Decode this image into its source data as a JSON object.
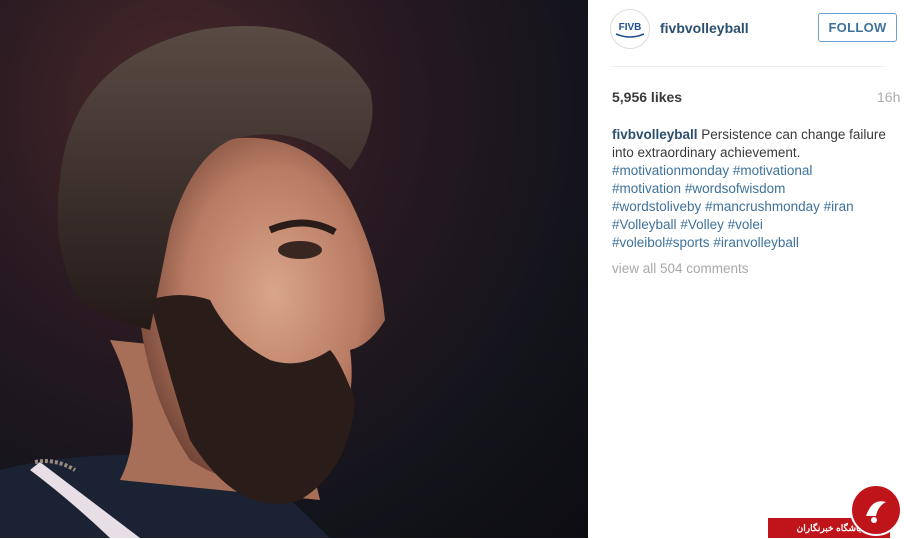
{
  "post": {
    "photo_alt": "",
    "account": {
      "username": "fivbvolleyball",
      "avatar_text": "FIVB",
      "follow_label": "FOLLOW"
    },
    "stats": {
      "likes": "5,956 likes",
      "time_ago": "16h"
    },
    "caption": {
      "username": "fivbvolleyball",
      "text": "Persistence can change failure into extraordinary achievement.",
      "hashtags": [
        "#motivationmonday",
        "#motivational",
        "#motivation",
        "#wordsofwisdom",
        "#wordstoliveby",
        "#mancrushmonday",
        "#iran",
        "#Volleyball",
        "#Volley",
        "#volei",
        "#voleibol#sports",
        "#iranvolleyball"
      ]
    },
    "comments_link": "view all 504 comments"
  },
  "watermark": {
    "text": "باشگاه خبرنگاران",
    "color": "#c0141b"
  }
}
